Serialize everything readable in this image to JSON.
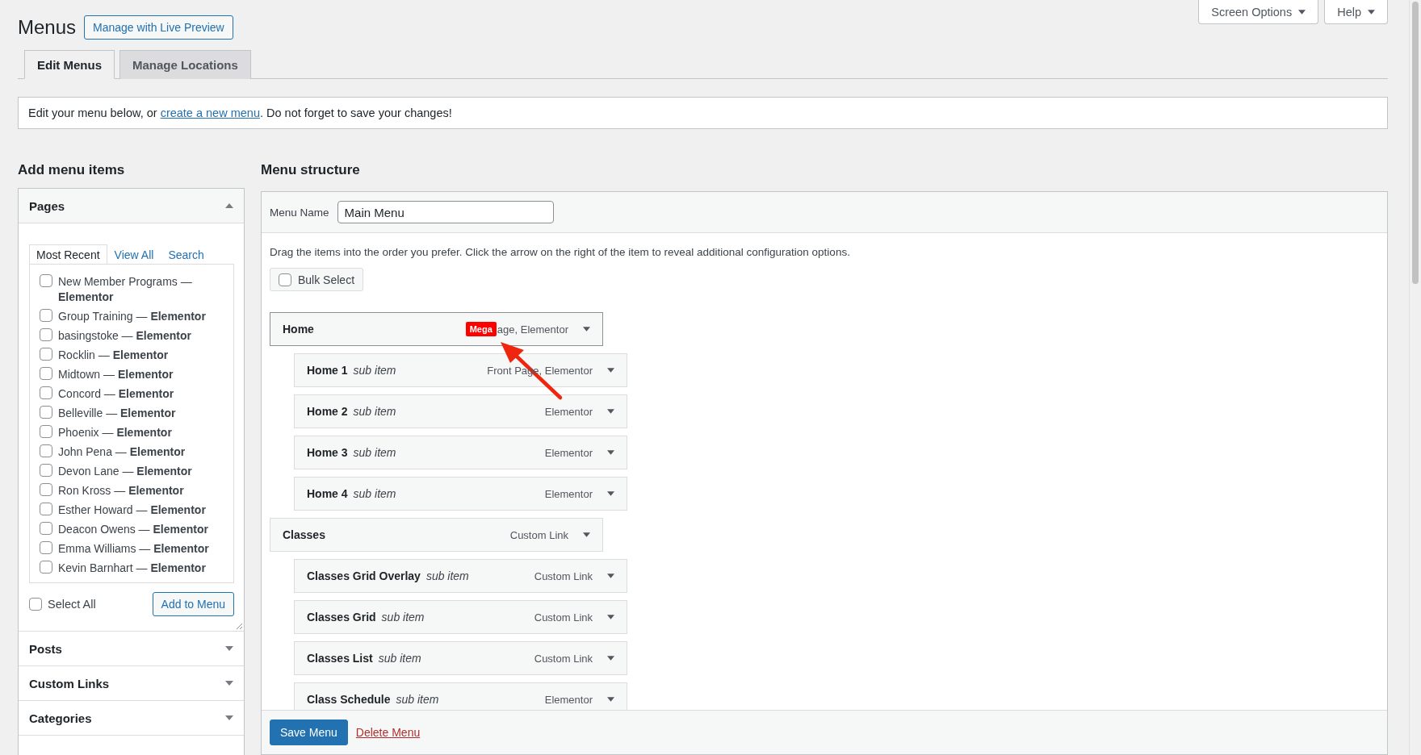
{
  "page_title": "Menus",
  "live_preview_button": "Manage with Live Preview",
  "top_buttons": [
    {
      "label": "Screen Options"
    },
    {
      "label": "Help"
    }
  ],
  "tabs": [
    {
      "label": "Edit Menus",
      "selected": true
    },
    {
      "label": "Manage Locations",
      "selected": false
    }
  ],
  "notice": {
    "before": "Edit your menu below, or ",
    "link": "create a new menu",
    "after": ". Do not forget to save your changes!"
  },
  "add_items": {
    "heading": "Add menu items",
    "sections": [
      {
        "title": "Pages",
        "expanded": true
      },
      {
        "title": "Posts",
        "expanded": false
      },
      {
        "title": "Custom Links",
        "expanded": false
      },
      {
        "title": "Categories",
        "expanded": false
      }
    ],
    "pages": {
      "tabs": [
        {
          "label": "Most Recent",
          "selected": true
        },
        {
          "label": "View All",
          "selected": false
        },
        {
          "label": "Search",
          "selected": false
        }
      ],
      "items": [
        {
          "label": "New Member Programs — **Elementor**",
          "checked": false
        },
        {
          "label": "Group Training — **Elementor**",
          "checked": false
        },
        {
          "label": "basingstoke — **Elementor**",
          "checked": false
        },
        {
          "label": "Rocklin — **Elementor**",
          "checked": false
        },
        {
          "label": "Midtown — **Elementor**",
          "checked": false
        },
        {
          "label": "Concord — **Elementor**",
          "checked": false
        },
        {
          "label": "Belleville — **Elementor**",
          "checked": false
        },
        {
          "label": "Phoenix — **Elementor**",
          "checked": false
        },
        {
          "label": "John Pena — **Elementor**",
          "checked": false
        },
        {
          "label": "Devon Lane — **Elementor**",
          "checked": false
        },
        {
          "label": "Ron Kross — **Elementor**",
          "checked": false
        },
        {
          "label": "Esther Howard — **Elementor**",
          "checked": false
        },
        {
          "label": "Deacon Owens — **Elementor**",
          "checked": false
        },
        {
          "label": "Emma Williams — **Elementor**",
          "checked": false
        },
        {
          "label": "Kevin Barnhart — **Elementor**",
          "checked": false
        }
      ],
      "select_all": {
        "label": "Select All",
        "checked": false
      },
      "add_button": "Add to Menu"
    }
  },
  "structure": {
    "heading": "Menu structure",
    "menu_name_label": "Menu Name",
    "menu_name": "Main Menu",
    "instructions": "Drag the items into the order you prefer. Click the arrow on the right of the item to reveal additional configuration options.",
    "bulk_select": {
      "label": "Bulk Select",
      "checked": false
    },
    "items": [
      {
        "title": "Home",
        "type": "age, Elementor",
        "badge": "Mega",
        "selected": true,
        "children": [
          {
            "title": "Home 1",
            "note": "sub item",
            "type": "Front Page, Elementor",
            "selected": false
          },
          {
            "title": "Home 2",
            "note": "sub item",
            "type": "Elementor",
            "selected": false
          },
          {
            "title": "Home 3",
            "note": "sub item",
            "type": "Elementor",
            "selected": false
          },
          {
            "title": "Home 4",
            "note": "sub item",
            "type": "Elementor",
            "selected": false
          }
        ]
      },
      {
        "title": "Classes",
        "type": "Custom Link",
        "selected": false,
        "children": [
          {
            "title": "Classes Grid Overlay",
            "note": "sub item",
            "type": "Custom Link",
            "selected": false
          },
          {
            "title": "Classes Grid",
            "note": "sub item",
            "type": "Custom Link",
            "selected": false
          },
          {
            "title": "Classes List",
            "note": "sub item",
            "type": "Custom Link",
            "selected": false
          },
          {
            "title": "Class Schedule",
            "note": "sub item",
            "type": "Elementor",
            "selected": false
          }
        ]
      }
    ],
    "save_button": "Save Menu",
    "delete_link": "Delete Menu"
  }
}
